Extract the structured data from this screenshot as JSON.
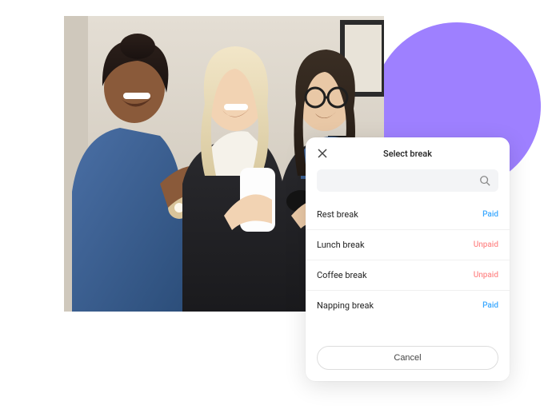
{
  "panel": {
    "title": "Select break",
    "search_placeholder": "",
    "breaks": [
      {
        "name": "Rest break",
        "status": "Paid",
        "status_kind": "paid"
      },
      {
        "name": "Lunch break",
        "status": "Unpaid",
        "status_kind": "unpaid"
      },
      {
        "name": "Coffee break",
        "status": "Unpaid",
        "status_kind": "unpaid"
      },
      {
        "name": "Napping break",
        "status": "Paid",
        "status_kind": "paid"
      }
    ],
    "cancel_label": "Cancel"
  }
}
